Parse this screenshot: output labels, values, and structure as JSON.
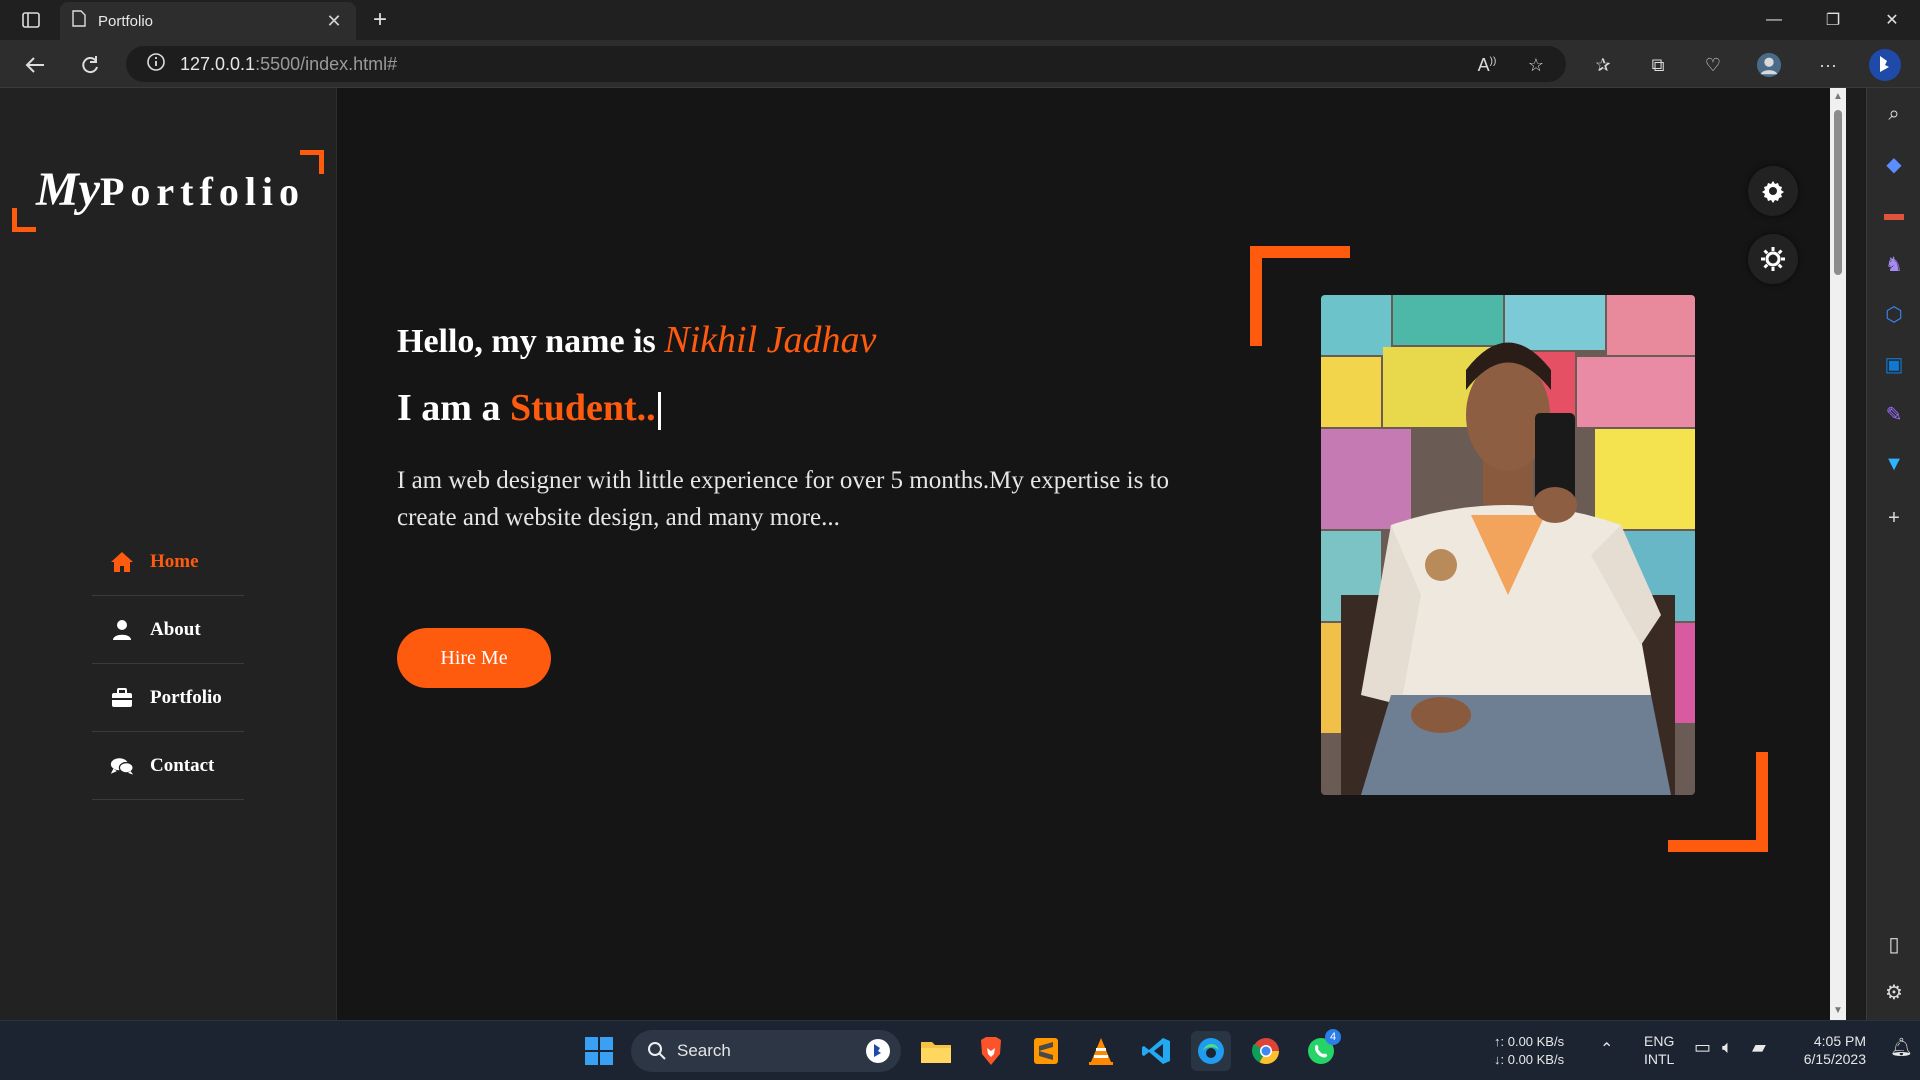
{
  "browser": {
    "tab_title": "Portfolio",
    "url_host": "127.0.0.1",
    "url_path": ":5500/index.html#"
  },
  "page": {
    "logo_script": "My",
    "logo_rest": "Portfolio",
    "nav": [
      {
        "label": "Home",
        "icon": "home-icon",
        "active": true
      },
      {
        "label": "About",
        "icon": "user-icon",
        "active": false
      },
      {
        "label": "Portfolio",
        "icon": "briefcase-icon",
        "active": false
      },
      {
        "label": "Contact",
        "icon": "comments-icon",
        "active": false
      }
    ],
    "hello_prefix": "Hello, my name is",
    "hello_name": "Nikhil Jadhav",
    "iam_prefix": "I am a",
    "iam_role": "Student..",
    "description": "I am web designer with little experience for over 5 months.My expertise is to create and website design, and many more...",
    "hire_label": "Hire Me"
  },
  "taskbar": {
    "search_label": "Search",
    "net_up": "↑: 0.00 KB/s",
    "net_down": "↓: 0.00 KB/s",
    "lang1": "ENG",
    "lang2": "INTL",
    "time": "4:05 PM",
    "date": "6/15/2023",
    "whatsapp_badge": "4"
  },
  "colors": {
    "accent": "#fe5b0f",
    "sidebar_bg": "#222222",
    "page_bg": "#151515"
  }
}
